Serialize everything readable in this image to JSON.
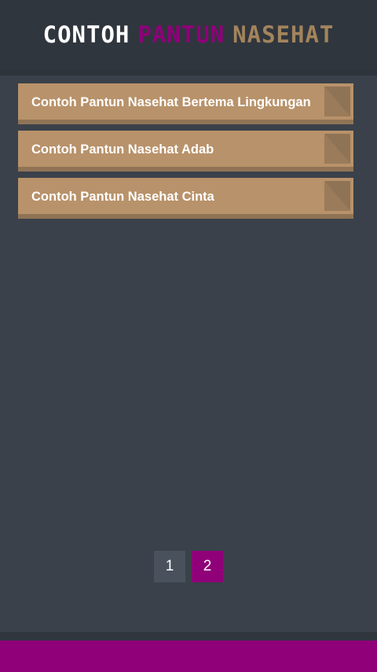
{
  "header": {
    "title_word1": "Contoh",
    "title_word2": "Pantun",
    "title_word3": "Nasehat"
  },
  "list": {
    "items": [
      {
        "label": "Contoh Pantun Nasehat Bertema Lingkungan"
      },
      {
        "label": "Contoh Pantun Nasehat Adab"
      },
      {
        "label": "Contoh Pantun Nasehat Cinta"
      }
    ]
  },
  "pagination": {
    "pages": [
      "1",
      "2"
    ],
    "current": "2"
  },
  "colors": {
    "background": "#3a414a",
    "header": "#30363e",
    "accent_magenta": "#8f0079",
    "accent_tan": "#b8926a"
  }
}
